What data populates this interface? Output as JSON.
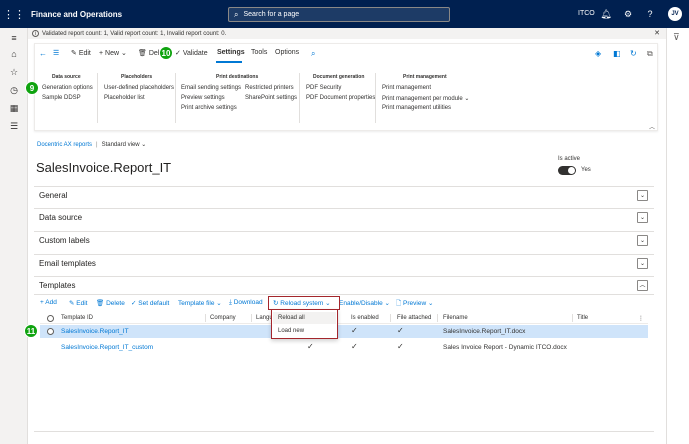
{
  "app": {
    "title": "Finance and Operations",
    "search_placeholder": "Search for a page",
    "company": "ITCO",
    "user_initials": "JV"
  },
  "message": {
    "text": "Validated report count: 1, Valid report count: 1, Invalid report count: 0."
  },
  "action_pane": {
    "edit": "Edit",
    "new": "New",
    "delete": "Del",
    "validate": "Validate",
    "tabs": [
      "Settings",
      "Tools",
      "Options"
    ],
    "groups": [
      {
        "title": "Data source",
        "items": [
          "Generation options",
          "Sample DDSP"
        ]
      },
      {
        "title": "Placeholders",
        "items": [
          "User-defined placeholders",
          "Placeholder list"
        ]
      },
      {
        "title": "Print destinations",
        "items": [
          "Email sending settings",
          "Preview settings",
          "Print archive settings",
          "Restricted printers",
          "SharePoint settings"
        ]
      },
      {
        "title": "Document generation",
        "items": [
          "PDF Security",
          "PDF Document properties"
        ]
      },
      {
        "title": "Print management",
        "items": [
          "Print management",
          "Print management per module",
          "Print management utilities"
        ]
      }
    ]
  },
  "badges": [
    "9",
    "10",
    "11"
  ],
  "breadcrumb": {
    "link": "Docentric AX reports",
    "view": "Standard view"
  },
  "page": {
    "title": "SalesInvoice.Report_IT",
    "is_active_label": "Is active",
    "is_active_value": "Yes"
  },
  "fasttabs": [
    "General",
    "Data source",
    "Custom labels",
    "Email templates",
    "Templates"
  ],
  "grid_toolbar": {
    "add": "Add",
    "edit": "Edit",
    "delete": "Delete",
    "set_default": "Set default",
    "template_file": "Template file",
    "download": "Download",
    "reload_system": "Reload system",
    "enable_disable": "Enable/Disable",
    "preview": "Preview"
  },
  "reload_menu": [
    "Reload all",
    "Load new"
  ],
  "grid": {
    "columns": [
      "Template ID",
      "Company",
      "Langua",
      "Is enabled",
      "File attached",
      "Filename",
      "Title"
    ],
    "rows": [
      {
        "template_id": "SalesInvoice.Report_IT",
        "filename": "SalesInvoice.Report_IT.docx"
      },
      {
        "template_id": "SalesInvoice.Report_IT_custom",
        "filename": "Sales Invoice Report - Dynamic ITCO.docx"
      }
    ]
  },
  "colors": {
    "topbar": "#002050",
    "accent": "#0078d4",
    "badge": "#0fa30f",
    "highlight": "#a4262c",
    "selected_row": "#cfe4fa"
  }
}
